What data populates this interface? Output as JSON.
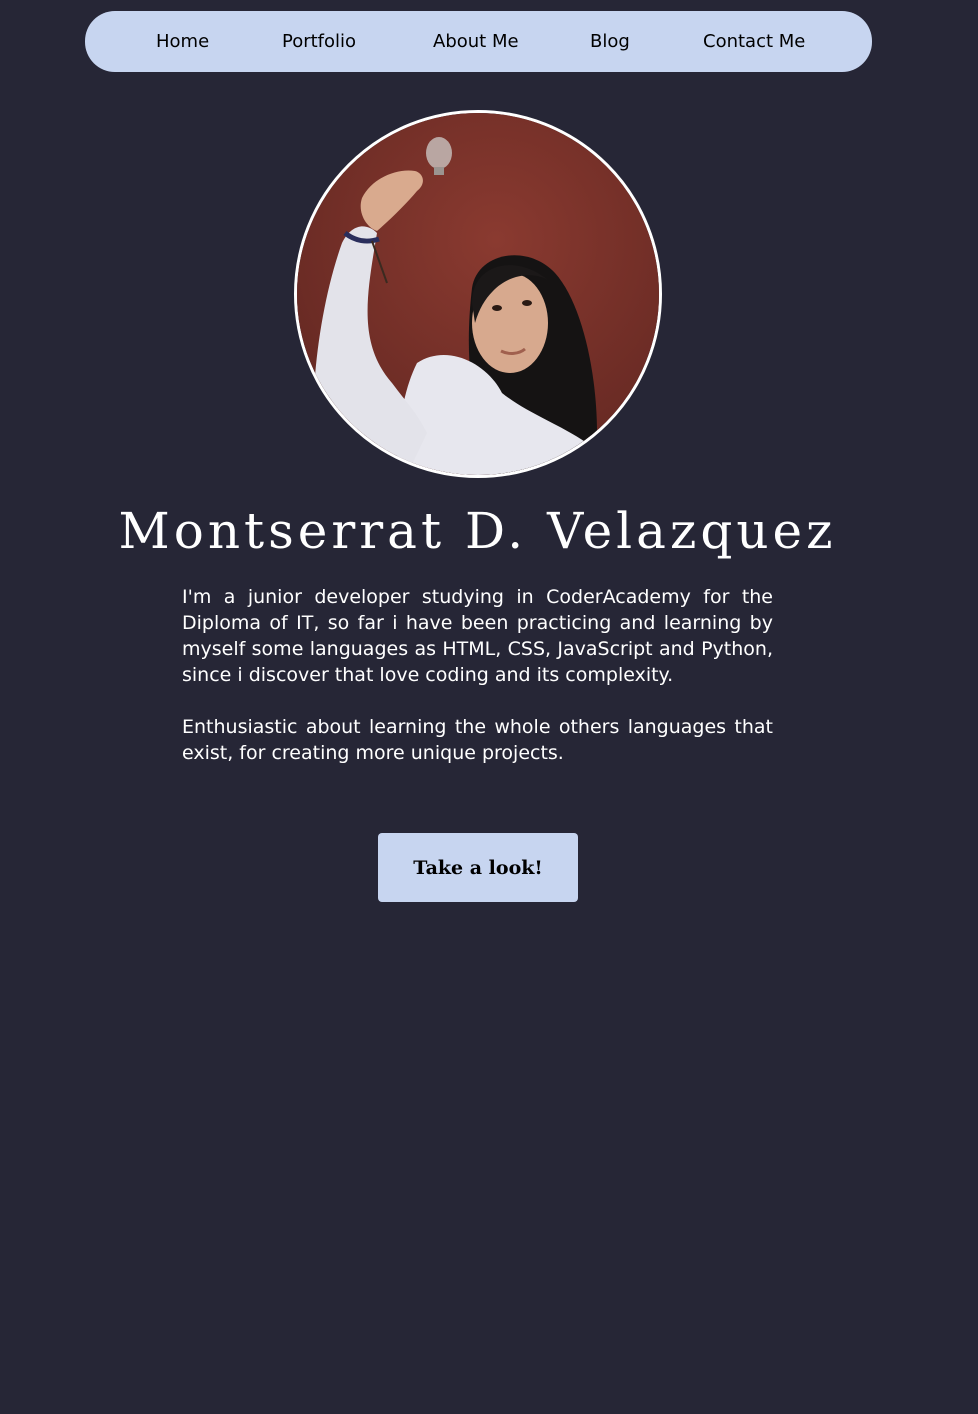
{
  "nav": {
    "items": [
      {
        "label": "Home"
      },
      {
        "label": "Portfolio"
      },
      {
        "label": "About Me"
      },
      {
        "label": "Blog"
      },
      {
        "label": "Contact Me"
      }
    ]
  },
  "profile": {
    "name": "Montserrat D. Velazquez",
    "bio": [
      "I'm a junior developer studying in CoderAcademy for the Diploma of IT, so far i have been practicing and learning by myself some languages as HTML, CSS, JavaScript and Python, since i discover that love coding and its complexity.",
      "Enthusiastic about learning the whole others languages that exist, for creating more unique projects."
    ]
  },
  "cta": {
    "label": "Take a look!"
  },
  "colors": {
    "background": "#262636",
    "accent": "#c7d5f0",
    "text": "#ffffff"
  }
}
